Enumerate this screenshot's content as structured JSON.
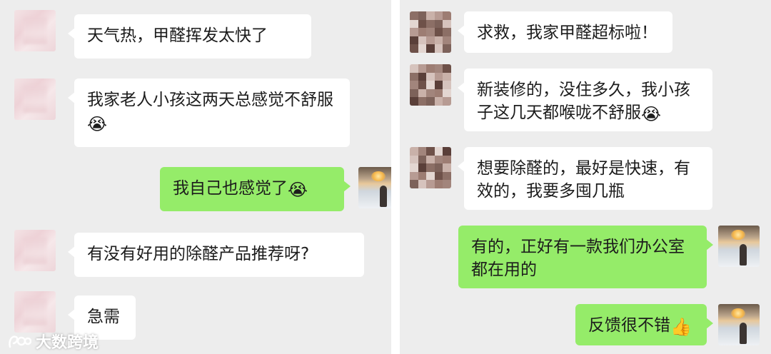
{
  "left_chat": {
    "messages": [
      {
        "text": "天气热，甲醛挥发太快了",
        "emoji": ""
      },
      {
        "text": "我家老人小孩这两天总感觉不舒服",
        "emoji": "😭"
      },
      {
        "text": "我自己也感觉了",
        "emoji": "😭"
      },
      {
        "text": "有没有好用的除醛产品推荐呀?",
        "emoji": ""
      },
      {
        "text": "急需",
        "emoji": ""
      }
    ]
  },
  "right_chat": {
    "messages": [
      {
        "text": "求救，我家甲醛超标啦！",
        "emoji": ""
      },
      {
        "text": "新装修的，没住多久，我小孩子这几天都喉咙不舒服",
        "emoji": "😭"
      },
      {
        "text": "想要除醛的，最好是快速，有效的，我要多囤几瓶",
        "emoji": ""
      },
      {
        "text": "有的，正好有一款我们办公室都在用的",
        "emoji": ""
      },
      {
        "text": "反馈很不错",
        "emoji": "👍"
      }
    ]
  },
  "watermark": {
    "text": "大数跨境"
  },
  "colors": {
    "chat_background": "#ededed",
    "incoming_bubble": "#ffffff",
    "outgoing_bubble": "#95ec69"
  }
}
